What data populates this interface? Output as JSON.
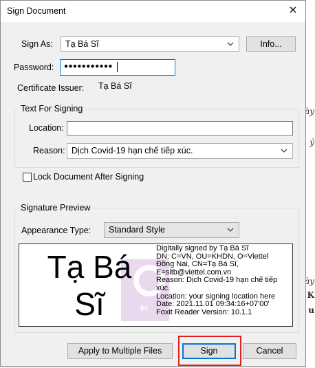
{
  "dialog": {
    "title": "Sign Document"
  },
  "sign_as": {
    "label": "Sign As:",
    "value": "Tạ Bá Sĩ",
    "info_button": "Info..."
  },
  "password": {
    "label": "Password:",
    "value": "●●●●●●●●●●●"
  },
  "certificate": {
    "label": "Certificate Issuer:",
    "value": "Tạ Bá Sĩ"
  },
  "text_for_signing": {
    "title": "Text For Signing",
    "location_label": "Location:",
    "location_value": "",
    "reason_label": "Reason:",
    "reason_value": "Dịch Covid-19 hạn chế tiếp xúc."
  },
  "lock": {
    "label": "Lock Document After Signing",
    "checked": false
  },
  "signature_preview": {
    "title": "Signature Preview",
    "appearance_label": "Appearance Type:",
    "appearance_value": "Standard Style",
    "name_line1": "Tạ Bá",
    "name_line2": "Sĩ",
    "info_lines": [
      "Digitally signed by Tạ Bá Sĩ",
      "DN: C=VN, OU=KHDN, O=Viettel",
      "Đồng Nai, CN=Tạ Bá Sĩ,",
      "E=sitb@viettel.com.vn",
      "Reason: Dịch Covid-19 hạn chế tiếp",
      "xúc.",
      "Location: your signing location here",
      "Date: 2021.11.01 09:34:16+07'00'",
      "Foxit Reader Version: 10.1.1"
    ],
    "watermark_text": "PI"
  },
  "buttons": {
    "apply_multiple": "Apply to Multiple Files",
    "sign": "Sign",
    "cancel": "Cancel"
  },
  "colors": {
    "highlight": "#e02020",
    "focus": "#0078d7"
  }
}
